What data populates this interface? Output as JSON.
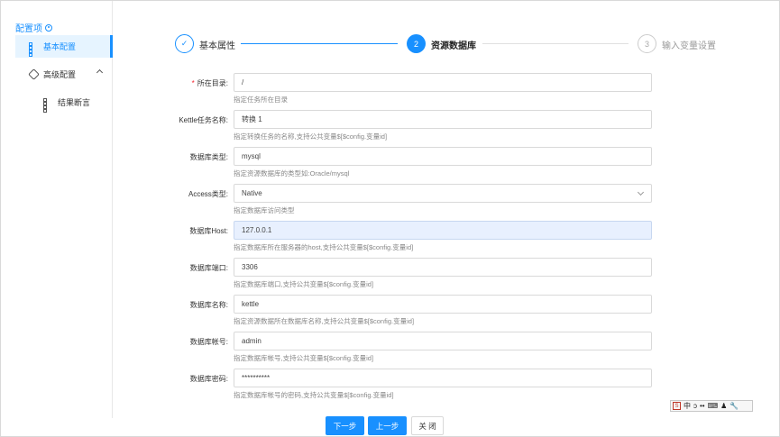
{
  "sidebar": {
    "title": "配置项",
    "items": [
      {
        "label": "基本配置",
        "icon": "grid-icon",
        "active": true
      },
      {
        "label": "高级配置",
        "icon": "cube-icon",
        "expanded": true
      },
      {
        "label": "结果断言",
        "icon": "grid-icon",
        "sub": true
      }
    ]
  },
  "steps": [
    {
      "number": "✓",
      "label": "基本属性",
      "status": "finished"
    },
    {
      "number": "2",
      "label": "资源数据库",
      "status": "process"
    },
    {
      "number": "3",
      "label": "输入变量设置",
      "status": "wait"
    }
  ],
  "form": [
    {
      "label": "所在目录:",
      "required": true,
      "value": "/",
      "hint": "指定任务所在目录"
    },
    {
      "label": "Kettle任务名称:",
      "value": "转换 1",
      "hint": "指定转换任务的名称,支持公共变量$[$config.变量id]"
    },
    {
      "label": "数据库类型:",
      "value": "mysql",
      "hint": "指定资源数据库的类型如:Oracle/mysql"
    },
    {
      "label": "Access类型:",
      "value": "Native",
      "hint": "指定数据库访问类型",
      "select": true
    },
    {
      "label": "数据库Host:",
      "value": "127.0.0.1",
      "hint": "指定数据库所在服务器的host,支持公共变量$[$config.变量id]",
      "highlight": true
    },
    {
      "label": "数据库端口:",
      "value": "3306",
      "hint": "指定数据库端口,支持公共变量$[$config.变量id]"
    },
    {
      "label": "数据库名称:",
      "value": "kettle",
      "hint": "指定资源数据所在数据库名称,支持公共变量$[$config.变量id]"
    },
    {
      "label": "数据库帐号:",
      "value": "admin",
      "hint": "指定数据库帐号,支持公共变量$[$config.变量id]"
    },
    {
      "label": "数据库密码:",
      "value": "**********",
      "hint": "指定数据库帐号的密码,支持公共变量$[$config.变量id]"
    }
  ],
  "buttons": {
    "next": "下一步",
    "prev": "上一步",
    "close": "关 闭"
  },
  "ime": {
    "label": "中",
    "items": [
      "中",
      "ↄ",
      "••",
      "⌨",
      "♟",
      "🔧"
    ]
  },
  "colors": {
    "primary": "#1890ff",
    "required": "#f5222d"
  }
}
